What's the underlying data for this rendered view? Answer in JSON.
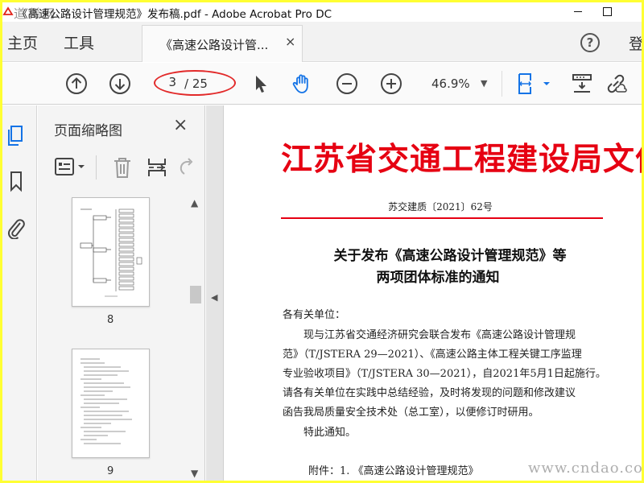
{
  "window": {
    "title": "《高速公路设计管理规范》发布稿.pdf - Adobe Acrobat Pro DC",
    "watermark_top": "道稀网"
  },
  "menu": {
    "home": "主页",
    "tools": "工具",
    "doc_tab": "《高速公路设计管...",
    "doc_tab_close": "×",
    "help": "?",
    "login": "登"
  },
  "toolbar": {
    "current_page": "3",
    "total_pages": "/ 25",
    "zoom": "46.9%",
    "zoom_caret": "▼"
  },
  "panel": {
    "title": "页面缩略图",
    "close": "×",
    "thumbs": [
      {
        "label": "8"
      },
      {
        "label": "9"
      }
    ]
  },
  "document": {
    "header_title": "江苏省交通工程建设局文件",
    "doc_number": "苏交建质〔2021〕62号",
    "notice_title_1": "关于发布《高速公路设计管理规范》等",
    "notice_title_2": "两项团体标准的通知",
    "lines": [
      "各有关单位：",
      "现与江苏省交通经济研究会联合发布《高速公路设计管理规",
      "范》（T/JSTERA 29—2021）、《高速公路主体工程关键工序监理",
      "专业验收项目》（T/JSTERA 30—2021），自2021年5月1日起施行。",
      "请各有关单位在实践中总结经验，及时将发现的问题和修改建议",
      "函告我局质量安全技术处（总工室），以便修订时研用。",
      "特此通知。",
      "附件：1. 《高速公路设计管理规范》"
    ],
    "watermark_bottom": "www.cndao.com"
  },
  "colors": {
    "frame_highlight": "#ffff33",
    "doc_red": "#e60012",
    "annotation_red": "#e22a2a",
    "accent_blue": "#1473e6"
  }
}
